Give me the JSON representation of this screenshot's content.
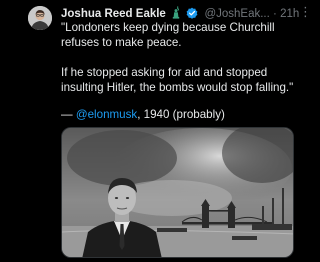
{
  "tweet": {
    "author_name": "Joshua Reed Eakle",
    "handle": "@JoshEak...",
    "separator": "·",
    "time": "21h",
    "more_label": "⋮",
    "lines": [
      "\"Londoners keep dying because Churchill",
      "refuses to make peace.",
      "If he stopped asking for aid and stopped",
      "insulting Hitler, the bombs would stop falling.\""
    ],
    "attribution_dash": "— ",
    "mention": "@elonmusk",
    "attribution_suffix": ", 1940 (probably)"
  },
  "icons": {
    "badge_left": "statue-of-liberty-icon",
    "badge_right": "verified-badge-icon"
  },
  "colors": {
    "background": "#000000",
    "text": "#e7e9ea",
    "muted": "#71767b",
    "link": "#1d9bf0",
    "verified": "#1d9bf0",
    "liberty": "#3aa17e"
  }
}
